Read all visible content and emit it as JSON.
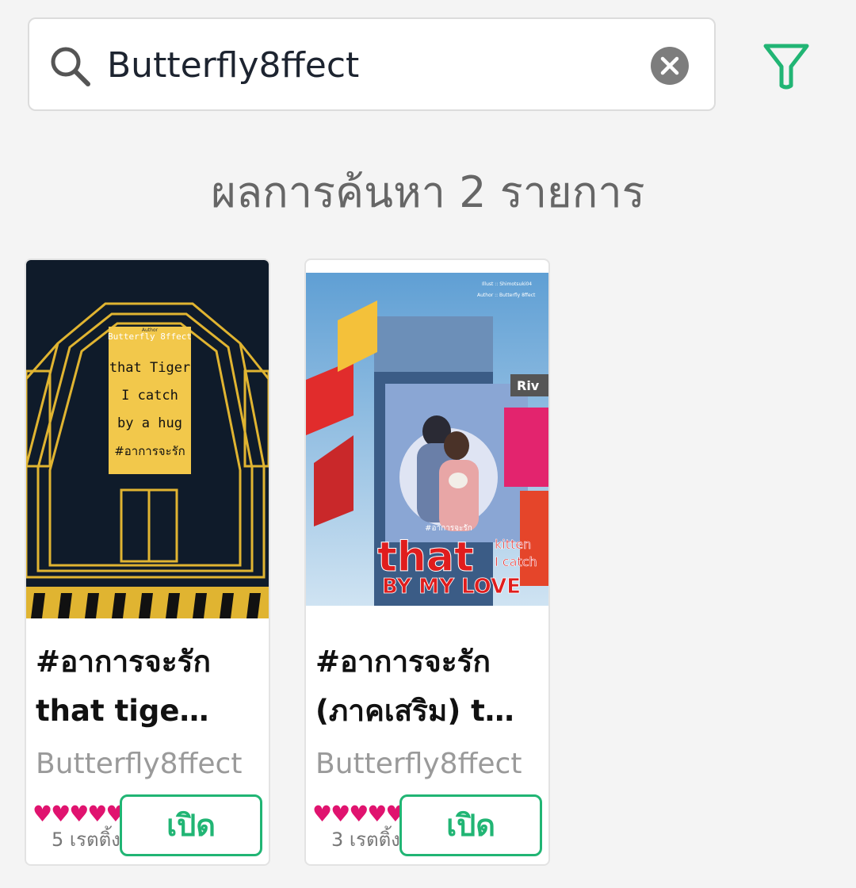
{
  "search": {
    "value": "Butterfly8ffect",
    "icon": "search-icon",
    "clear_icon": "clear-icon",
    "filter_icon": "filter-icon",
    "accent_color": "#21b574"
  },
  "results": {
    "count_label": "ผลการค้นหา 2 รายการ"
  },
  "cover1": {
    "author_label": "Author",
    "author": "Butterfly 8ffect",
    "line1": "that Tiger",
    "line2": "I catch",
    "line3": "by a hug",
    "line4": "#อาการจะรัก"
  },
  "cover2": {
    "illust": "Illust :: Shimotsuki04",
    "author": "Author :: Butterfly 8ffect",
    "hashtag": "#อาการจะรัก",
    "word1": "that",
    "word2": "kitten",
    "word3": "I catch",
    "word4": "BY MY LOVE",
    "sign": "Riv"
  },
  "books": [
    {
      "title": "#อาการจะรัก  that tige…",
      "author": "Butterfly8ffect",
      "hearts": "♥♥♥♥♥",
      "ratings": "5 เรตติ้ง",
      "open_label": "เปิด"
    },
    {
      "title": "#อาการจะรัก (ภาคเสริม)  t…",
      "author": "Butterfly8ffect",
      "hearts": "♥♥♥♥♥",
      "ratings": "3 เรตติ้ง",
      "open_label": "เปิด"
    }
  ]
}
